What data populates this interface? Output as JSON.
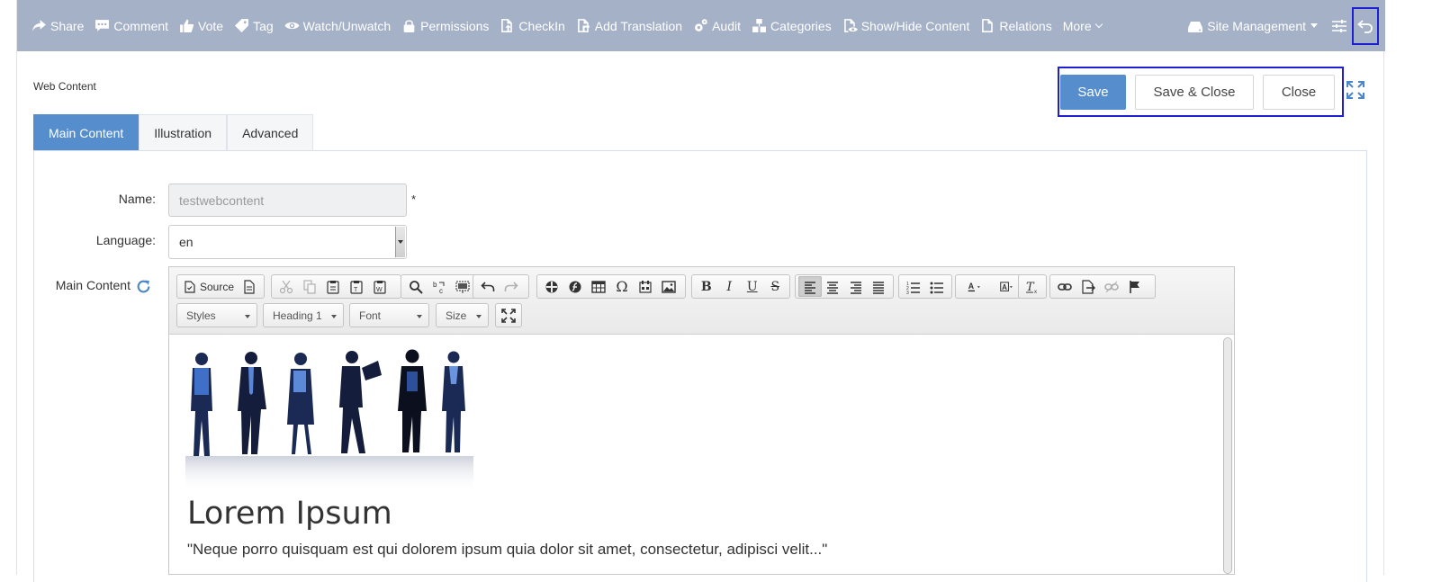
{
  "topbar": {
    "actions": [
      {
        "label": "Share",
        "icon": "share-icon"
      },
      {
        "label": "Comment",
        "icon": "comment-icon"
      },
      {
        "label": "Vote",
        "icon": "thumbs-up-icon"
      },
      {
        "label": "Tag",
        "icon": "tag-icon"
      },
      {
        "label": "Watch/Unwatch",
        "icon": "eye-icon"
      },
      {
        "label": "Permissions",
        "icon": "lock-icon"
      },
      {
        "label": "CheckIn",
        "icon": "checkin-icon"
      },
      {
        "label": "Add Translation",
        "icon": "translation-icon"
      },
      {
        "label": "Audit",
        "icon": "gears-icon"
      },
      {
        "label": "Categories",
        "icon": "categories-icon"
      },
      {
        "label": "Show/Hide Content",
        "icon": "show-hide-icon"
      },
      {
        "label": "Relations",
        "icon": "relations-icon"
      }
    ],
    "more_label": "More",
    "site_management_label": "Site Management"
  },
  "header": {
    "title": "Web Content",
    "save_label": "Save",
    "save_close_label": "Save & Close",
    "close_label": "Close"
  },
  "tabs": [
    {
      "label": "Main Content",
      "active": true
    },
    {
      "label": "Illustration",
      "active": false
    },
    {
      "label": "Advanced",
      "active": false
    }
  ],
  "form": {
    "name_label": "Name:",
    "name_value": "testwebcontent",
    "required_mark": "*",
    "language_label": "Language:",
    "language_value": "en",
    "main_content_label": "Main Content"
  },
  "editor": {
    "source_label": "Source",
    "styles_label": "Styles",
    "heading_label": "Heading 1",
    "font_label": "Font",
    "size_label": "Size",
    "bold_glyph": "B",
    "italic_glyph": "I",
    "underline_glyph": "U",
    "strike_glyph": "S",
    "omega_glyph": "Ω",
    "content_title": "Lorem Ipsum",
    "content_quote": "\"Neque porro quisquam est qui dolorem ipsum quia dolor sit amet, consectetur, adipisci velit...\""
  },
  "colors": {
    "topbar_bg": "#a5b1c6",
    "primary": "#568dcd",
    "highlight_border": "#1d20d1"
  }
}
